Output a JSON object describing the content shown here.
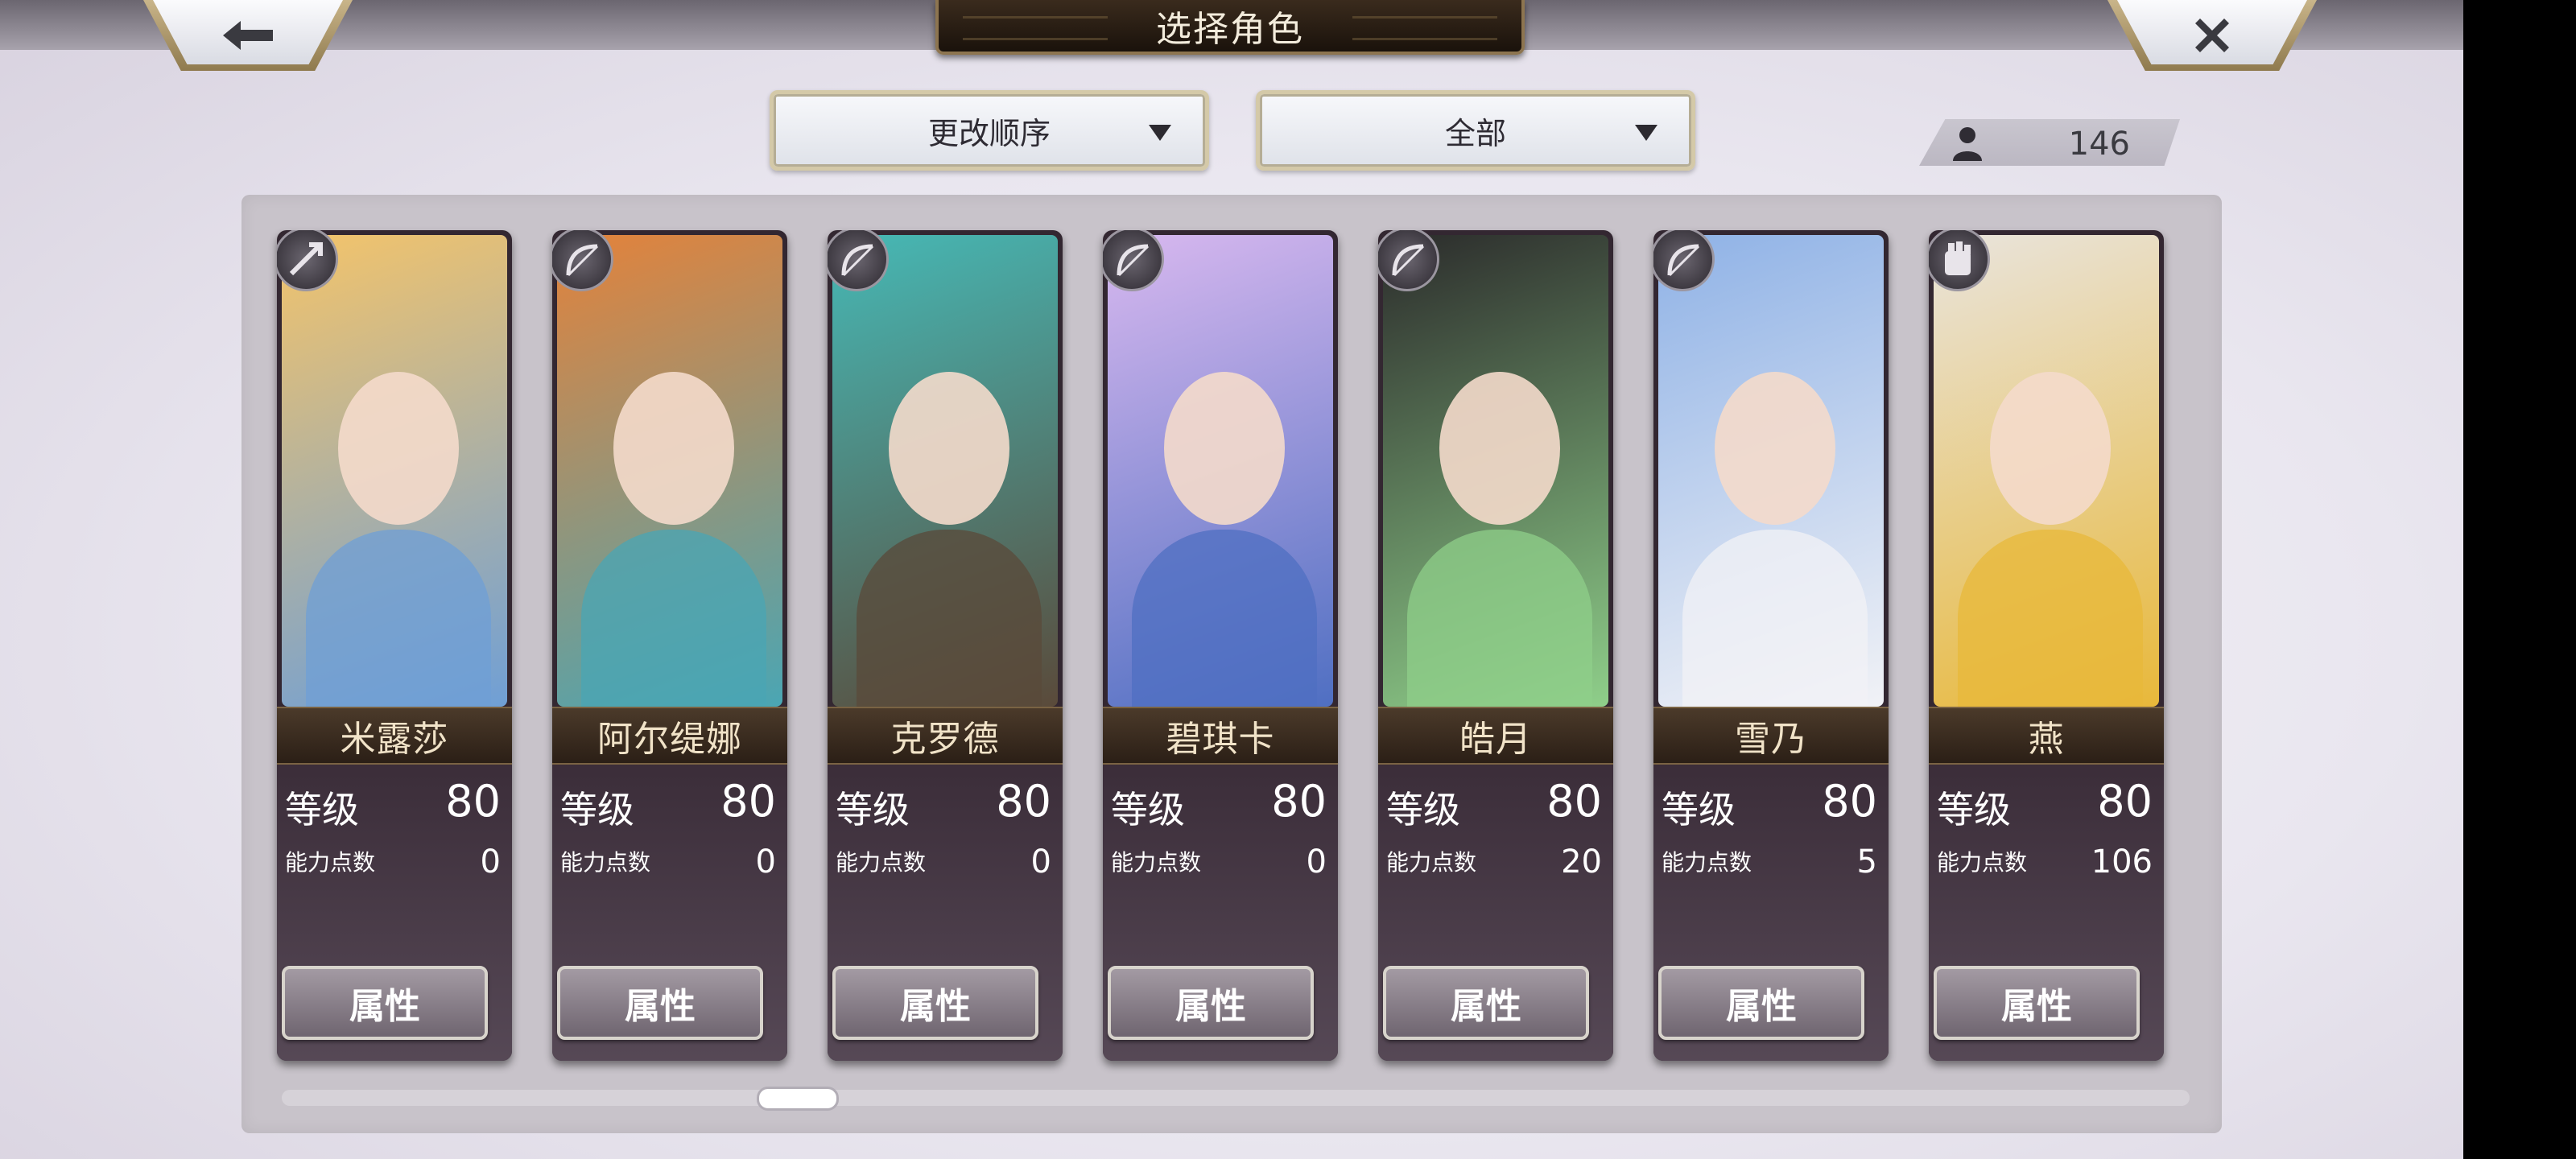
{
  "header": {
    "title": "选择角色",
    "back_icon": "arrow-left-icon",
    "close_icon": "close-x-icon"
  },
  "controls": {
    "sort_label": "更改顺序",
    "filter_label": "全部",
    "character_count": "146",
    "count_icon": "person-icon"
  },
  "labels": {
    "level": "等级",
    "points": "能力点数",
    "attributes": "属性"
  },
  "characters": [
    {
      "name": "米露莎",
      "level": "80",
      "points": "0",
      "class_icon": "arrow-bow-icon",
      "color_a": "#f4c46a",
      "color_b": "#6f9fd6"
    },
    {
      "name": "阿尔缇娜",
      "level": "80",
      "points": "0",
      "class_icon": "bow-icon",
      "color_a": "#e4823a",
      "color_b": "#4aa6b4"
    },
    {
      "name": "克罗德",
      "level": "80",
      "points": "0",
      "class_icon": "bow-icon",
      "color_a": "#46b9b6",
      "color_b": "#5a4a3a"
    },
    {
      "name": "碧琪卡",
      "level": "80",
      "points": "0",
      "class_icon": "bow-icon",
      "color_a": "#d8b8ef",
      "color_b": "#4f6fc2"
    },
    {
      "name": "皓月",
      "level": "80",
      "points": "20",
      "class_icon": "bow-icon",
      "color_a": "#2b2b2b",
      "color_b": "#8fcf8a"
    },
    {
      "name": "雪乃",
      "level": "80",
      "points": "5",
      "class_icon": "bow-icon",
      "color_a": "#8fb2e6",
      "color_b": "#f1f2f6"
    },
    {
      "name": "燕",
      "level": "80",
      "points": "106",
      "class_icon": "gauntlet-icon",
      "color_a": "#e9e4dc",
      "color_b": "#e8b83a"
    }
  ],
  "scroll": {
    "position": 0.26
  }
}
